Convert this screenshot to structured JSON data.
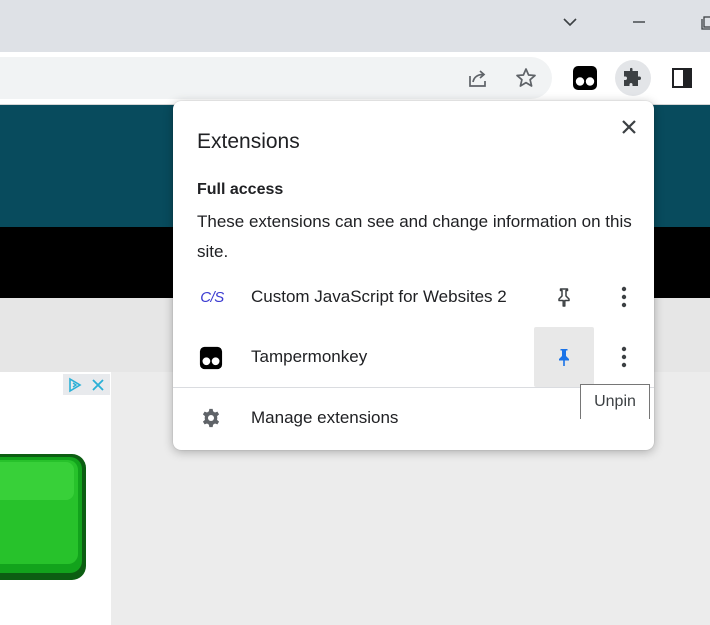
{
  "window": {
    "icons": [
      "chevron-down-icon",
      "minimize-icon",
      "maximize-icon"
    ]
  },
  "toolbar": {
    "icons": [
      "share-icon",
      "star-icon",
      "tampermonkey-icon",
      "puzzle-icon",
      "side-panel-icon"
    ]
  },
  "popup": {
    "title": "Extensions",
    "section_heading": "Full access",
    "section_description": "These extensions can see and change information on this site.",
    "extensions": [
      {
        "icon_text": "C/S",
        "name": "Custom JavaScript for Websites 2",
        "pinned": false
      },
      {
        "icon_text": "",
        "name": "Tampermonkey",
        "pinned": true
      }
    ],
    "manage_label": "Manage extensions"
  },
  "tooltip": {
    "text": "Unpin"
  },
  "colors": {
    "teal_band": "#084b5d",
    "pin_active": "#1a73e8",
    "cjs_icon": "#3b3bd1"
  }
}
